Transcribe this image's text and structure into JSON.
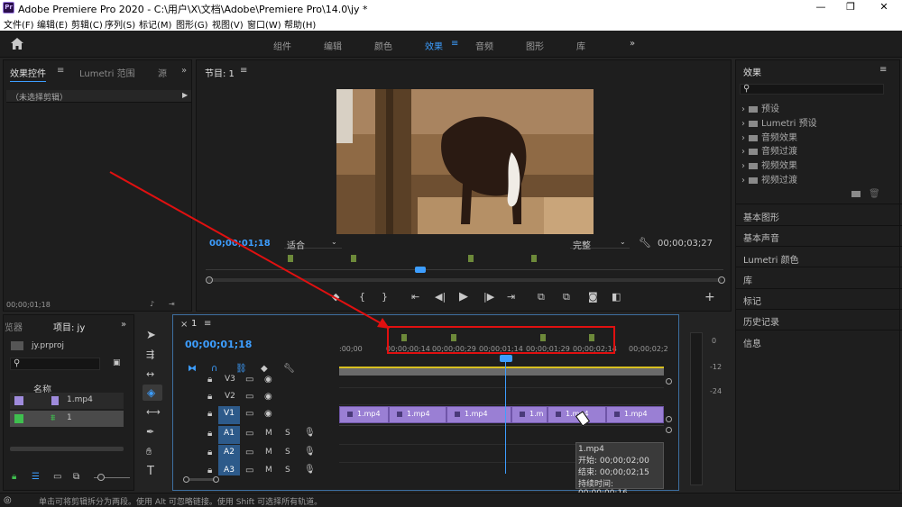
{
  "window": {
    "title": "Adobe Premiere Pro 2020 - C:\\用户\\X\\文档\\Adobe\\Premiere Pro\\14.0\\jy *",
    "logo_text": "Pr",
    "minimize": "—",
    "restore": "❐",
    "close": "✕"
  },
  "menu": [
    "文件(F)",
    "编辑(E)",
    "剪辑(C)",
    "序列(S)",
    "标记(M)",
    "图形(G)",
    "视图(V)",
    "窗口(W)",
    "帮助(H)"
  ],
  "workspaces": {
    "items": [
      "组件",
      "编辑",
      "颜色",
      "效果",
      "音频",
      "图形",
      "库"
    ],
    "active": "效果",
    "more": "»"
  },
  "effect_controls": {
    "tab_active": "效果控件",
    "tab_menu": "≡",
    "tab2": "Lumetri 范围",
    "tab3": "源",
    "more": "»",
    "no_clip": "（未选择剪辑）",
    "timecode": "00;00;01;18"
  },
  "program_monitor": {
    "title": "节目: 1",
    "menu": "≡",
    "timecode_left": "00;00;01;18",
    "fit": "适合",
    "quality": "完整",
    "timecode_right": "00;00;03;27"
  },
  "project": {
    "tab_prev": "览器",
    "tab_active": "项目: jy",
    "more": "»",
    "filename": "jy.prproj",
    "column_name": "名称",
    "items": [
      {
        "name": "1.mp4",
        "color": "#9f8bdc"
      },
      {
        "name": "1",
        "color": "#3fbf4f"
      }
    ]
  },
  "timeline": {
    "close": "×",
    "seq_name": "1",
    "menu": "≡",
    "timecode": "00;00;01;18",
    "ruler": [
      ":00;00",
      "00;00;00;14",
      "00;00;00;29",
      "00;00;01;14",
      "00;00;01;29",
      "00;00;02;14",
      "00;00;02;2"
    ],
    "tracks_video": [
      "V3",
      "V2",
      "V1"
    ],
    "tracks_audio": [
      "A1",
      "A2",
      "A3"
    ],
    "track_m": "M",
    "track_s": "S",
    "clips": [
      {
        "label": "1.mp4"
      },
      {
        "label": "1.mp4"
      },
      {
        "label": "1.mp4"
      },
      {
        "label": "1.m"
      },
      {
        "label": "1.mp4"
      },
      {
        "label": "1.mp4"
      }
    ],
    "tooltip": {
      "name": "1.mp4",
      "start": "开始: 00;00;02;00",
      "end": "结束: 00;00;02;15",
      "duration": "持续时间: 00;00;00;16"
    }
  },
  "meters": {
    "labels": [
      "0",
      "-12",
      "-24"
    ]
  },
  "effects": {
    "title": "效果",
    "menu": "≡",
    "folders": [
      "预设",
      "Lumetri 预设",
      "音频效果",
      "音频过渡",
      "视频效果",
      "视频过渡"
    ],
    "sections": [
      "基本图形",
      "基本声音",
      "Lumetri 颜色",
      "库",
      "标记",
      "历史记录",
      "信息"
    ]
  },
  "status": {
    "text": "单击可将剪辑拆分为两段。使用 Alt 可忽略链接。使用 Shift 可选择所有轨道。"
  },
  "colors": {
    "accent": "#3d9eff",
    "annotation": "#e01010",
    "clip": "#9a7fd4"
  }
}
